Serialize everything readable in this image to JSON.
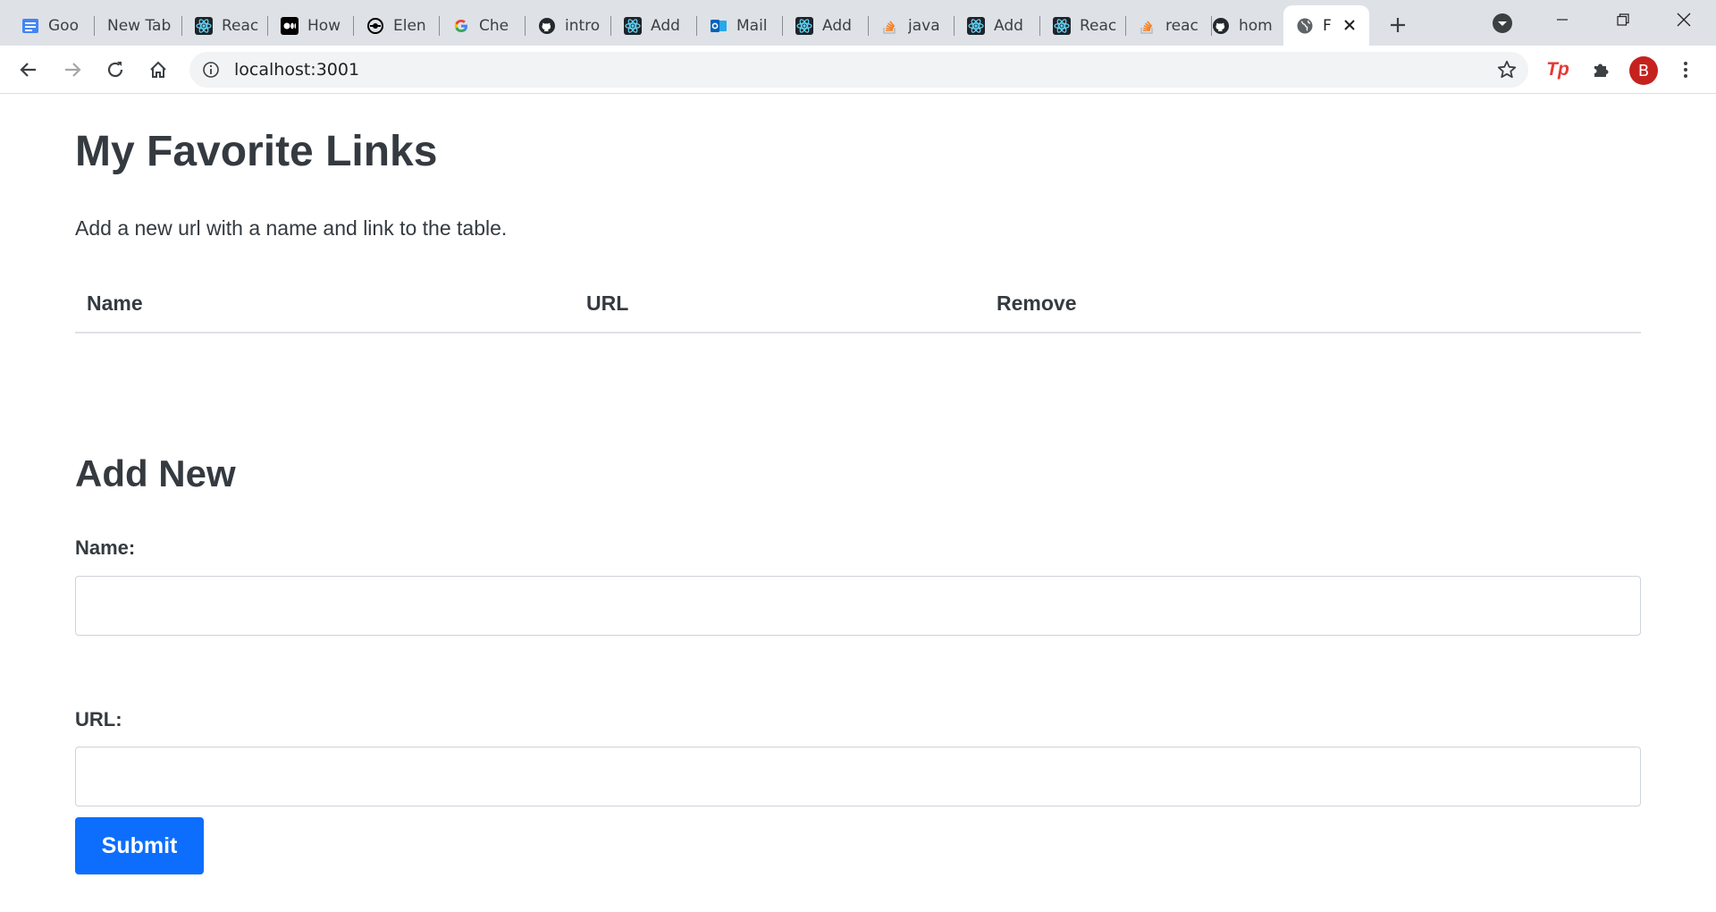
{
  "browser": {
    "tabs": [
      {
        "title": "Goo",
        "icon": "google-docs-icon"
      },
      {
        "title": "New Tab",
        "icon": ""
      },
      {
        "title": "Reac",
        "icon": "react-icon"
      },
      {
        "title": "How",
        "icon": "medium-icon"
      },
      {
        "title": "Elen",
        "icon": "element-icon"
      },
      {
        "title": "Che",
        "icon": "google-icon"
      },
      {
        "title": "intro",
        "icon": "github-icon"
      },
      {
        "title": "Add",
        "icon": "react-icon"
      },
      {
        "title": "Mail",
        "icon": "outlook-icon"
      },
      {
        "title": "Add",
        "icon": "react-icon"
      },
      {
        "title": "java",
        "icon": "stackoverflow-icon"
      },
      {
        "title": "Add",
        "icon": "react-icon"
      },
      {
        "title": "Reac",
        "icon": "react-icon"
      },
      {
        "title": "reac",
        "icon": "stackoverflow-icon"
      },
      {
        "title": "hom",
        "icon": "github-icon"
      },
      {
        "title": "F",
        "icon": "globe-icon",
        "active": true
      }
    ],
    "address": "localhost:3001",
    "profile_initial": "B",
    "extension_label": "Tp"
  },
  "page": {
    "title": "My Favorite Links",
    "description": "Add a new url with a name and link to the table.",
    "table": {
      "headers": [
        "Name",
        "URL",
        "Remove"
      ],
      "rows": []
    },
    "form": {
      "heading": "Add New",
      "name_label": "Name:",
      "name_value": "",
      "url_label": "URL:",
      "url_value": "",
      "submit_label": "Submit"
    }
  },
  "colors": {
    "accent": "#0d6efd",
    "text": "#343a40",
    "avatar": "#c5221f"
  }
}
